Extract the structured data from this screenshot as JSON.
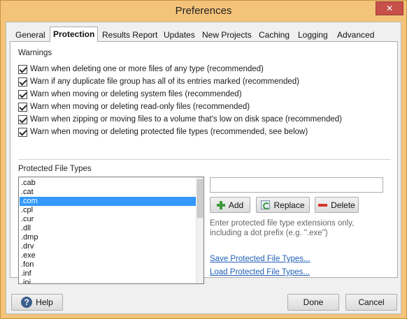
{
  "window": {
    "title": "Preferences",
    "close_glyph": "✕"
  },
  "tabs": [
    {
      "label": "General"
    },
    {
      "label": "Protection"
    },
    {
      "label": "Results Report"
    },
    {
      "label": "Updates"
    },
    {
      "label": "New Projects"
    },
    {
      "label": "Caching"
    },
    {
      "label": "Logging"
    },
    {
      "label": "Advanced"
    }
  ],
  "warnings": {
    "heading": "Warnings",
    "items": [
      {
        "label": "Warn when deleting one or more files of any type (recommended)",
        "checked": true
      },
      {
        "label": "Warn if any duplicate file group has all of its entries marked (recommended)",
        "checked": true
      },
      {
        "label": "Warn when moving or deleting system files (recommended)",
        "checked": true
      },
      {
        "label": "Warn when moving or deleting read-only files (recommended)",
        "checked": true
      },
      {
        "label": "Warn when zipping or moving files to a volume that's low on disk space (recommended)",
        "checked": true
      },
      {
        "label": "Warn when moving or deleting protected file types (recommended, see below)",
        "checked": true
      }
    ]
  },
  "protected": {
    "heading": "Protected File Types",
    "extensions": [
      ".cab",
      ".cat",
      ".com",
      ".cpl",
      ".cur",
      ".dll",
      ".dmp",
      ".drv",
      ".exe",
      ".fon",
      ".inf",
      ".ini"
    ],
    "selected": ".com",
    "input_value": "",
    "add_label": "Add",
    "replace_label": "Replace",
    "delete_label": "Delete",
    "hint": "Enter protected file type extensions only, including a dot prefix (e.g. \".exe\")",
    "save_link": "Save Protected File Types...",
    "load_link": "Load Protected File Types..."
  },
  "footer": {
    "help_label": "Help",
    "done_label": "Done",
    "cancel_label": "Cancel"
  },
  "colors": {
    "titlebar": "#f4c37a",
    "selection": "#3399ff",
    "link": "#1f5fb8",
    "close": "#c7504a"
  }
}
